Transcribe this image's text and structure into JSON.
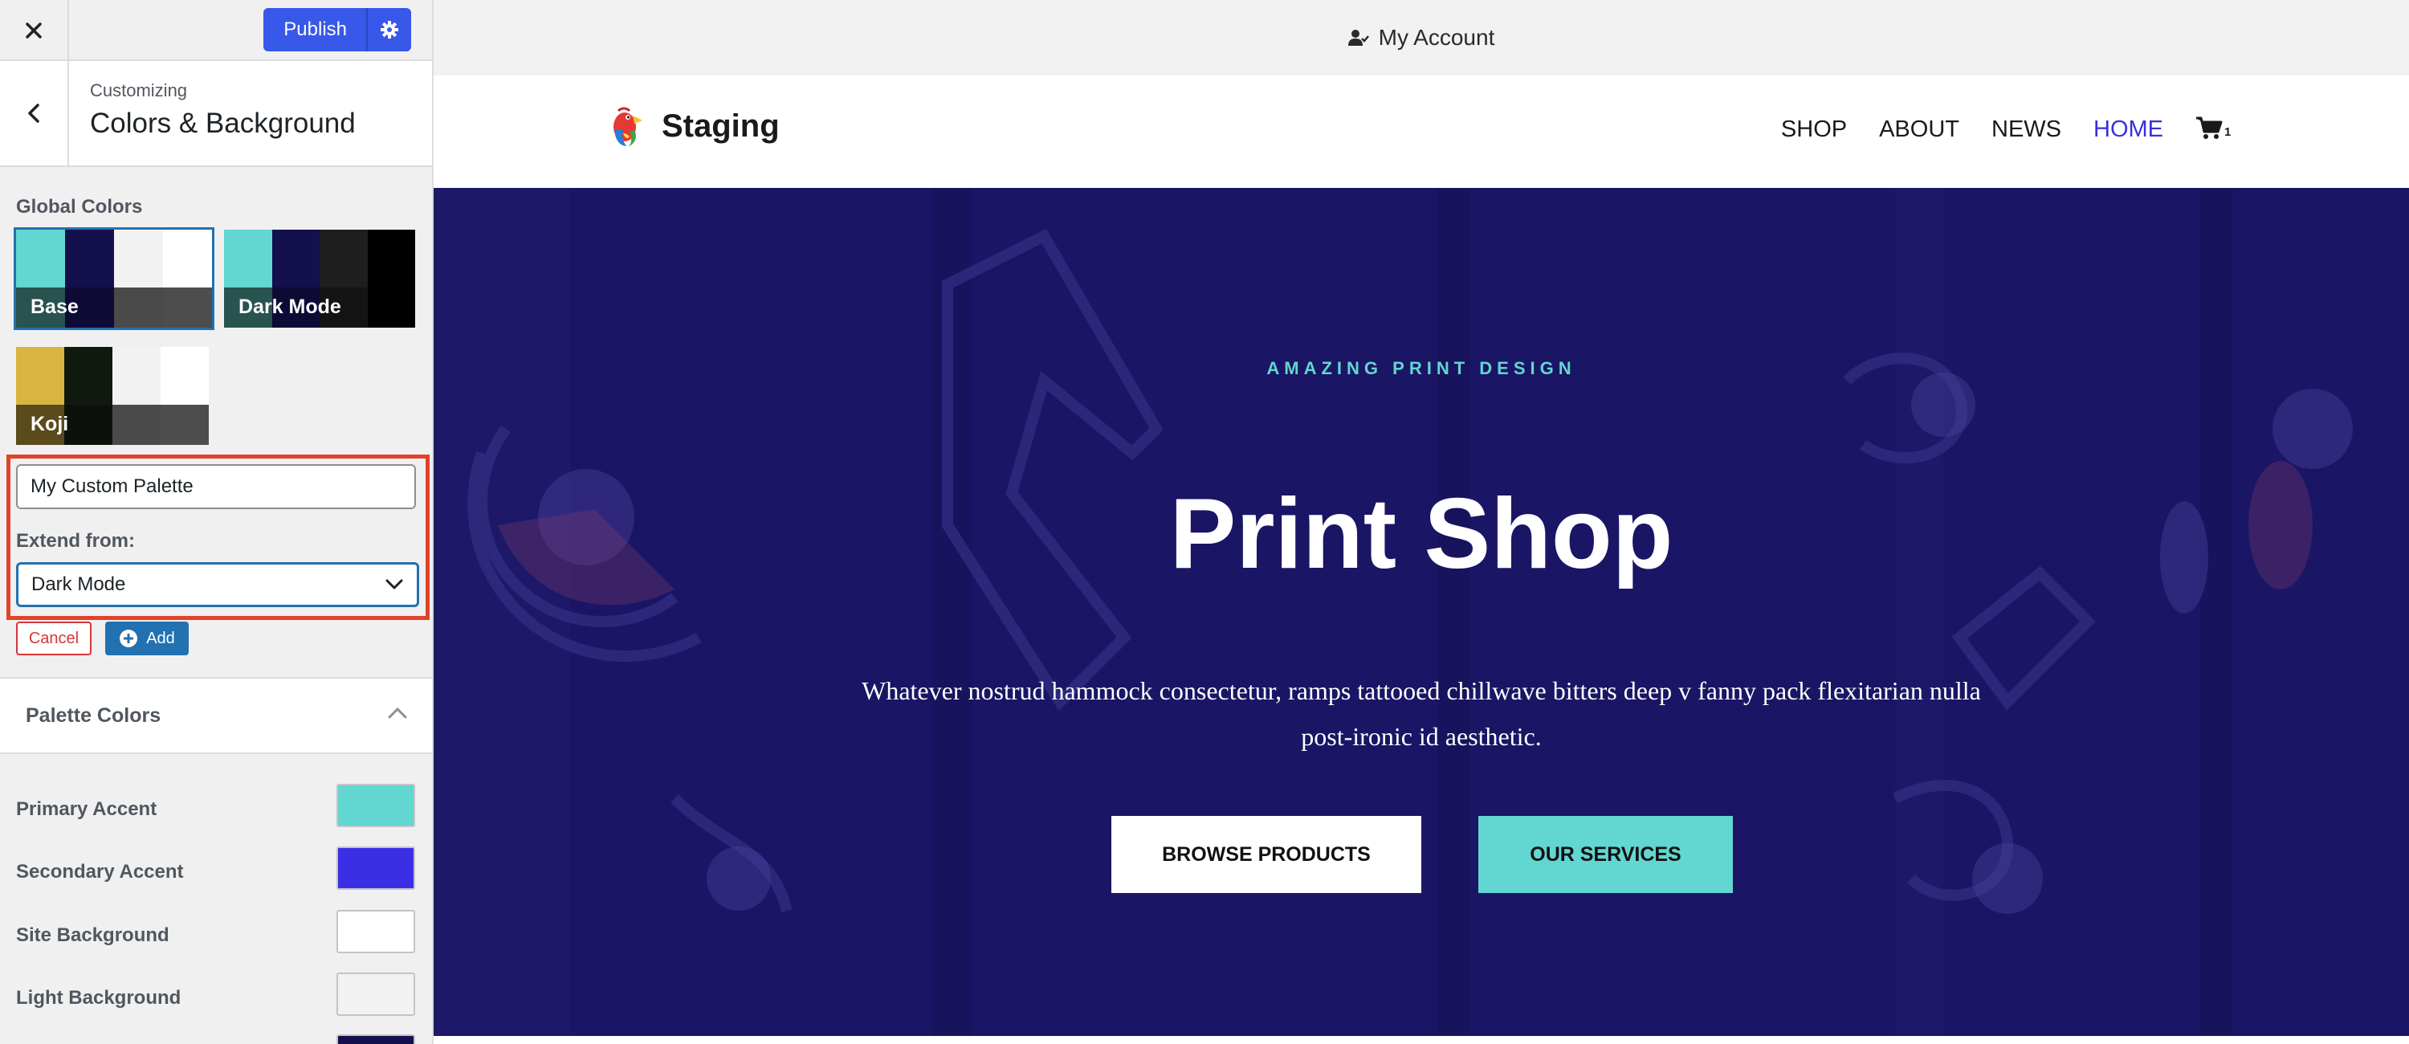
{
  "customizer": {
    "publish_label": "Publish",
    "crumb": "Customizing",
    "section_title": "Colors & Background",
    "global_colors_label": "Global Colors",
    "palettes": [
      {
        "name": "Base",
        "selected": true,
        "colors": [
          "#62d6d0",
          "#13104d",
          "#f2f2f2",
          "#ffffff"
        ]
      },
      {
        "name": "Dark Mode",
        "selected": false,
        "colors": [
          "#62d6d0",
          "#13104d",
          "#1e1e1e",
          "#000000"
        ]
      },
      {
        "name": "Koji",
        "selected": false,
        "colors": [
          "#d9b440",
          "#111a10",
          "#f2f2f2",
          "#ffffff"
        ]
      }
    ],
    "custom_palette": {
      "name_value": "My Custom Palette",
      "extend_label": "Extend from:",
      "extend_value": "Dark Mode",
      "cancel_label": "Cancel",
      "add_label": "Add"
    },
    "palette_colors_label": "Palette Colors",
    "palette_colors": [
      {
        "label": "Primary Accent",
        "color": "#62d6d0"
      },
      {
        "label": "Secondary Accent",
        "color": "#3b2fe6"
      },
      {
        "label": "Site Background",
        "color": "#ffffff"
      },
      {
        "label": "Light Background",
        "color": "#f2f2f2"
      },
      {
        "label": "",
        "color": "#13104d"
      }
    ]
  },
  "preview": {
    "account_label": "My Account",
    "site_title": "Staging",
    "nav": [
      {
        "label": "SHOP",
        "active": false
      },
      {
        "label": "ABOUT",
        "active": false
      },
      {
        "label": "NEWS",
        "active": false
      },
      {
        "label": "HOME",
        "active": true
      }
    ],
    "cart_count": "1",
    "hero": {
      "eyebrow": "AMAZING PRINT DESIGN",
      "title": "Print Shop",
      "body": "Whatever nostrud hammock consectetur, ramps tattooed chillwave bitters deep v fanny pack flexitarian nulla post-ironic id aesthetic.",
      "primary_button": "BROWSE PRODUCTS",
      "secondary_button": "OUR SERVICES"
    }
  },
  "colors": {
    "accent_blue": "#3858e9",
    "hero_bg": "#1a1565",
    "teal": "#62d6d0",
    "highlight_red": "#e1432a"
  }
}
